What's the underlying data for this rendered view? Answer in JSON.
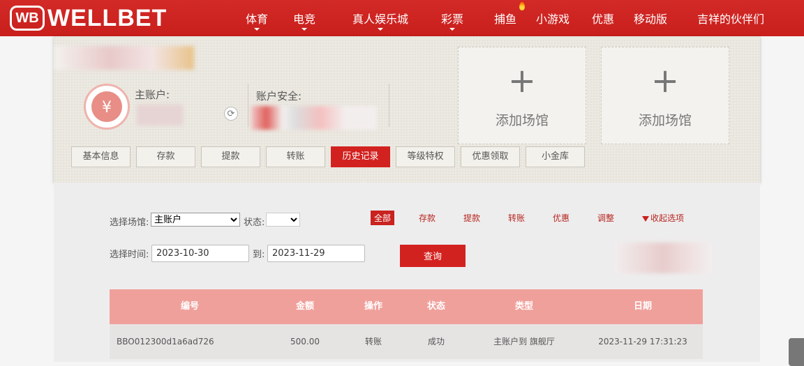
{
  "brand": {
    "logo_mark": "WB",
    "logo_text": "WELLBET"
  },
  "nav": [
    {
      "label": "体育",
      "dropdown": true
    },
    {
      "label": "电竞",
      "dropdown": true
    },
    {
      "label": "真人娱乐城",
      "dropdown": true
    },
    {
      "label": "彩票",
      "dropdown": true
    },
    {
      "label": "捕鱼",
      "dropdown": false,
      "hot": true
    },
    {
      "label": "小游戏",
      "dropdown": false
    },
    {
      "label": "优惠",
      "dropdown": false
    },
    {
      "label": "移动版",
      "dropdown": false
    },
    {
      "label": "吉祥的伙伴们",
      "dropdown": false
    }
  ],
  "account": {
    "main_account_label": "主账户:",
    "security_label": "账户安全:",
    "currency_symbol": "¥",
    "refresh_icon": "refresh-icon"
  },
  "venues": [
    {
      "plus": "+",
      "label": "添加场馆"
    },
    {
      "plus": "+",
      "label": "添加场馆"
    }
  ],
  "tabs": [
    "基本信息",
    "存款",
    "提款",
    "转账",
    "历史记录",
    "等级特权",
    "优惠领取",
    "小金库"
  ],
  "active_tab": 4,
  "filters": {
    "venue_label": "选择场馆:",
    "venue_value": "主账户",
    "status_label": "状态:",
    "time_label": "选择时间:",
    "date_from": "2023-10-30",
    "to_label": "到:",
    "date_to": "2023-11-29",
    "query_button": "查询",
    "type_tabs": [
      "全部",
      "存款",
      "提款",
      "转账",
      "优惠",
      "调整"
    ],
    "collapse_label": "收起选项"
  },
  "table": {
    "headers": [
      "编号",
      "金额",
      "操作",
      "状态",
      "类型",
      "日期"
    ],
    "rows": [
      [
        "BBO012300d1a6ad726",
        "500.00",
        "转账",
        "成功",
        "主账户到 旗舰厅",
        "2023-11-29 17:31:23"
      ]
    ]
  },
  "colors": {
    "brand_red": "#d2221f",
    "table_header": "#f0a09b"
  }
}
